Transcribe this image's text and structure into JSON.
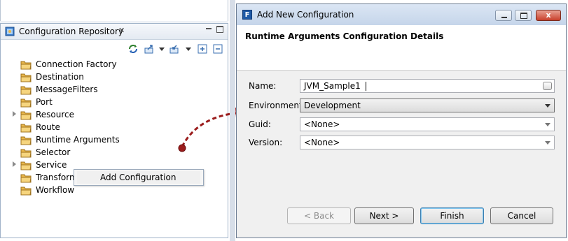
{
  "left_panel": {
    "title": "Configuration Repository",
    "close_label": "✕",
    "tree": [
      {
        "label": "Connection Factory",
        "expandable": false
      },
      {
        "label": "Destination",
        "expandable": false
      },
      {
        "label": "MessageFilters",
        "expandable": false
      },
      {
        "label": "Port",
        "expandable": false
      },
      {
        "label": "Resource",
        "expandable": true
      },
      {
        "label": "Route",
        "expandable": false
      },
      {
        "label": "Runtime Arguments",
        "expandable": false
      },
      {
        "label": "Selector",
        "expandable": false
      },
      {
        "label": "Service",
        "expandable": true
      },
      {
        "label": "Transformation",
        "expandable": false
      },
      {
        "label": "Workflow",
        "expandable": false
      }
    ],
    "context_menu": {
      "item": "Add Configuration"
    },
    "toolbar_icons": [
      "refresh-icon",
      "export-icon",
      "dropdown-icon",
      "import-icon",
      "dropdown-icon",
      "expand-all-icon",
      "collapse-all-icon"
    ]
  },
  "dialog": {
    "title": "Add New Configuration",
    "title_icon": "F",
    "close_glyph": "x",
    "header": "Runtime Arguments Configuration Details",
    "fields": {
      "name": {
        "label": "Name:",
        "value": "JVM_Sample1"
      },
      "environment": {
        "label": "Environment:",
        "value": "Development"
      },
      "guid": {
        "label": "Guid:",
        "value": "<None>"
      },
      "version": {
        "label": "Version:",
        "value": "<None>"
      }
    },
    "buttons": {
      "back": "< Back",
      "next": "Next >",
      "finish": "Finish",
      "cancel": "Cancel"
    }
  },
  "colors": {
    "folder": "#e8b64a",
    "arrow": "#9b1c1c",
    "title_bar": "#c5d5ea",
    "close_button": "#c8402b"
  }
}
